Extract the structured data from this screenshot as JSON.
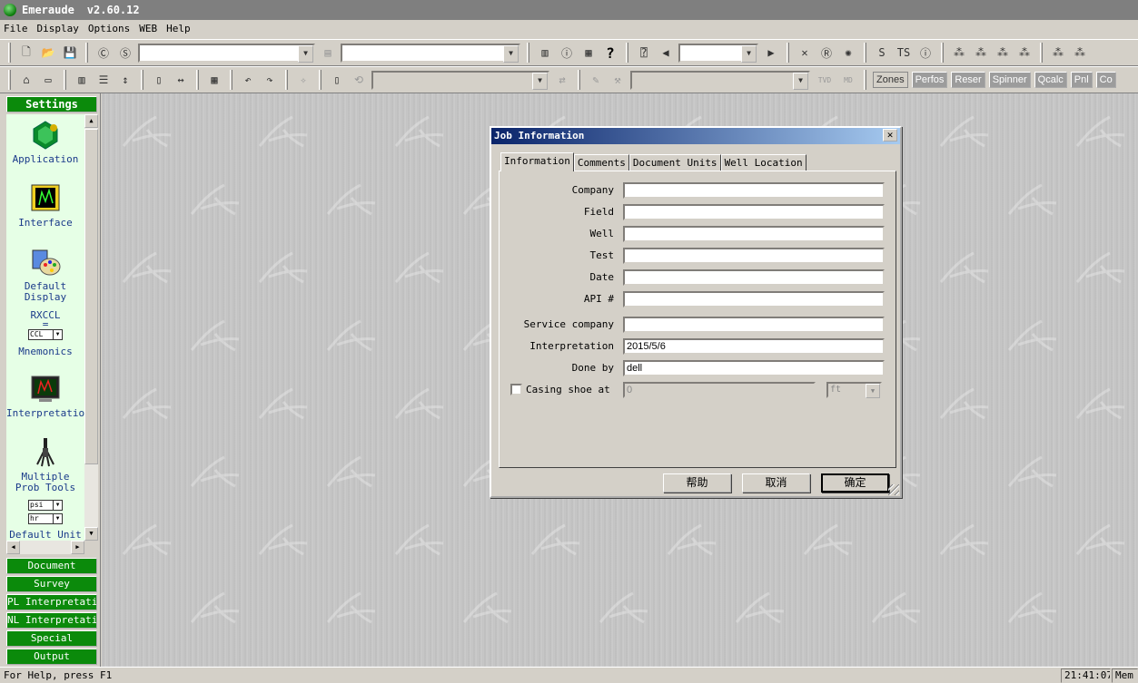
{
  "window": {
    "app_name": "Emeraude",
    "version": "v2.60.12"
  },
  "menu": [
    "File",
    "Display",
    "Options",
    "WEB",
    "Help"
  ],
  "toolbar2": {
    "tvd": "TVD",
    "md": "MD",
    "buttons": [
      "Zones",
      "Perfos",
      "Reser",
      "Spinner",
      "Qcalc",
      "Pnl",
      "Co"
    ]
  },
  "settings": {
    "header": "Settings",
    "items": {
      "application": "Application",
      "interface": "Interface",
      "default_display": "Default Display",
      "rxccl": "RXCCL",
      "eq": "=",
      "ccl_select": "CCL",
      "mnemonics": "Mnemonics",
      "interpretation": "Interpretatio",
      "multiple_probe": "Multiple Prob Tools",
      "psi_select": "psi",
      "hr_select": "hr",
      "default_units": "Default Unit"
    }
  },
  "nav": [
    "Document",
    "Survey",
    "PL Interpretation",
    "NL Interpretation",
    "Special",
    "Output"
  ],
  "dialog": {
    "title": "Job Information",
    "close": "✕",
    "tabs": [
      "Information",
      "Comments",
      "Document Units",
      "Well Location"
    ],
    "fields": [
      {
        "label": "Company",
        "value": ""
      },
      {
        "label": "Field",
        "value": ""
      },
      {
        "label": "Well",
        "value": ""
      },
      {
        "label": "Test",
        "value": ""
      },
      {
        "label": "Date",
        "value": ""
      },
      {
        "label": "API #",
        "value": ""
      },
      {
        "label": "Service company",
        "value": ""
      },
      {
        "label": "Interpretation",
        "value": "2015/5/6"
      },
      {
        "label": "Done by",
        "value": "dell"
      }
    ],
    "casing": {
      "label": "Casing shoe at",
      "value": "0",
      "unit": "ft"
    },
    "buttons": {
      "help": "帮助",
      "cancel": "取消",
      "ok": "确定"
    }
  },
  "status": {
    "help_text": "For Help, press F1",
    "time": "21:41:07",
    "mem": "Mem :"
  }
}
